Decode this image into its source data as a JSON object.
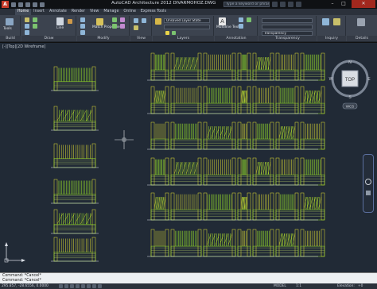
{
  "title_bar": {
    "app_title": "AutoCAD Architecture 2012   DIVARMOHOZ.DWG",
    "search_placeholder": "Type a keyword or phrase"
  },
  "ribbon": {
    "tabs": [
      "Home",
      "Insert",
      "Annotate",
      "Render",
      "View",
      "Manage",
      "Online",
      "Express Tools"
    ],
    "active_tab": "Home",
    "groups": [
      {
        "label": "Build",
        "items": [
          "Tools"
        ]
      },
      {
        "label": "Draw",
        "items": [
          "Line"
        ]
      },
      {
        "label": "Modify",
        "items": [
          "Match Properties"
        ]
      },
      {
        "label": "View",
        "items": []
      },
      {
        "label": "Layers",
        "items": [
          "Unsaved Layer State"
        ]
      },
      {
        "label": "Annotation",
        "items": [
          "Multiline Text"
        ]
      },
      {
        "label": "Transparency",
        "items": [
          "Transparency"
        ]
      },
      {
        "label": "Inquiry",
        "items": []
      },
      {
        "label": "Details",
        "items": []
      }
    ]
  },
  "viewport": {
    "label": "[-][Top][2D Wireframe]",
    "viewcube": {
      "face": "TOP",
      "north": "N",
      "south": "S",
      "east": "E",
      "west": "W"
    },
    "wcs_label": "WCS"
  },
  "command_line": {
    "lines": [
      "Command: *Cancel*",
      "Command: *Cancel*"
    ]
  },
  "status_bar": {
    "coordinates": "295.857,  -28.6556, 0.0000",
    "model_label": "MODEL",
    "scale": "1:1",
    "elevation_label": "Elevation:",
    "elevation_value": "+0"
  },
  "colors": {
    "accent_red": "#c63b2a",
    "drawing_bg": "#212a36",
    "fence_green": "#9ee82a",
    "fence_yellow": "#e7e433"
  }
}
